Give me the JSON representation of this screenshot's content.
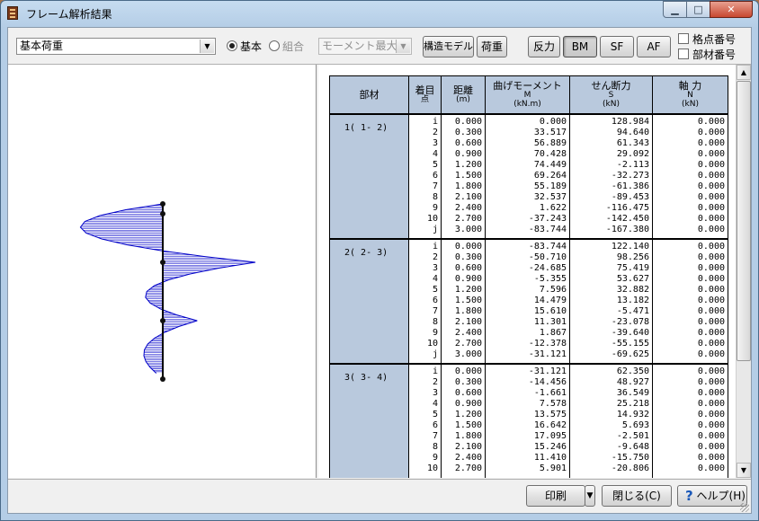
{
  "window": {
    "title": "フレーム解析結果",
    "minimize_icon": "minimize-icon",
    "maximize_icon": "maximize-icon",
    "close_icon": "close-icon"
  },
  "toolbar": {
    "load_case": "基本荷重",
    "radio_basic": "基本",
    "radio_combo": "組合",
    "moment_select": "モーメント最大",
    "structure_model_button": "構造モデル",
    "load_button": "荷重",
    "reaction_button": "反力",
    "bm_button": "BM",
    "sf_button": "SF",
    "af_button": "AF",
    "node_number_check": "格点番号",
    "member_number_check": "部材番号"
  },
  "table": {
    "headers": {
      "member": "部材",
      "point": "着目",
      "point_sub": "点",
      "distance": "距離",
      "distance_sub": "(m)",
      "moment": "曲げモーメント",
      "moment_sub1": "M",
      "moment_sub2": "(kN.m)",
      "shear": "せん断力",
      "shear_sub1": "S",
      "shear_sub2": "(kN)",
      "axial": "軸 力",
      "axial_sub1": "N",
      "axial_sub2": "(kN)"
    },
    "groups": [
      {
        "member": "1( 1- 2)",
        "points": "i\n2\n3\n4\n5\n6\n7\n8\n9\n10\nj",
        "distance": "0.000\n0.300\n0.600\n0.900\n1.200\n1.500\n1.800\n2.100\n2.400\n2.700\n3.000",
        "moment": "0.000\n33.517\n56.889\n70.428\n74.449\n69.264\n55.189\n32.537\n1.622\n-37.243\n-83.744",
        "shear": "128.984\n94.640\n61.343\n29.092\n-2.113\n-32.273\n-61.386\n-89.453\n-116.475\n-142.450\n-167.380",
        "axial": "0.000\n0.000\n0.000\n0.000\n0.000\n0.000\n0.000\n0.000\n0.000\n0.000\n0.000"
      },
      {
        "member": "2( 2- 3)",
        "points": "i\n2\n3\n4\n5\n6\n7\n8\n9\n10\nj",
        "distance": "0.000\n0.300\n0.600\n0.900\n1.200\n1.500\n1.800\n2.100\n2.400\n2.700\n3.000",
        "moment": "-83.744\n-50.710\n-24.685\n-5.355\n7.596\n14.479\n15.610\n11.301\n1.867\n-12.378\n-31.121",
        "shear": "122.140\n98.256\n75.419\n53.627\n32.882\n13.182\n-5.471\n-23.078\n-39.640\n-55.155\n-69.625",
        "axial": "0.000\n0.000\n0.000\n0.000\n0.000\n0.000\n0.000\n0.000\n0.000\n0.000\n0.000"
      },
      {
        "member": "3( 3- 4)",
        "points": "i\n2\n3\n4\n5\n6\n7\n8\n9\n10",
        "distance": "0.000\n0.300\n0.600\n0.900\n1.200\n1.500\n1.800\n2.100\n2.400\n2.700",
        "moment": "-31.121\n-14.456\n-1.661\n7.578\n13.575\n16.642\n17.095\n15.246\n11.410\n5.901",
        "shear": "62.350\n48.927\n36.549\n25.218\n14.932\n5.693\n-2.501\n-9.648\n-15.750\n-20.806",
        "axial": "0.000\n0.000\n0.000\n0.000\n0.000\n0.000\n0.000\n0.000\n0.000\n0.000"
      }
    ]
  },
  "footer": {
    "print_button": "印刷",
    "close_button": "閉じる(C)",
    "help_button": "ヘルプ(H)",
    "help_icon": "question-icon"
  },
  "diagram": {
    "members": [
      {
        "moments": [
          0.0,
          33.517,
          56.889,
          70.428,
          74.449,
          69.264,
          55.189,
          32.537,
          1.622,
          -37.243,
          -83.744
        ]
      },
      {
        "moments": [
          -83.744,
          -50.71,
          -24.685,
          -5.355,
          7.596,
          14.479,
          15.61,
          11.301,
          1.867,
          -12.378,
          -31.121
        ]
      },
      {
        "moments": [
          -31.121,
          -14.456,
          -1.661,
          7.578,
          13.575,
          16.642,
          17.095,
          15.246,
          11.41,
          5.901
        ]
      }
    ],
    "line_color": "#0000c8",
    "member_color": "#000000"
  }
}
